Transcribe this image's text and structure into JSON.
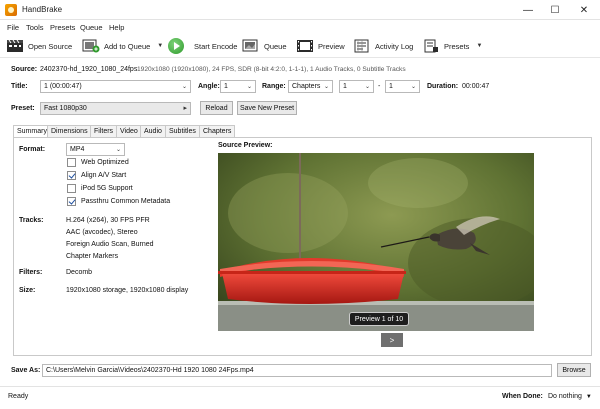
{
  "window": {
    "title": "HandBrake",
    "minimize": "—",
    "maximize": "☐",
    "close": "✕"
  },
  "menu": [
    "File",
    "Tools",
    "Presets",
    "Queue",
    "Help"
  ],
  "toolbar": {
    "open_source": "Open Source",
    "add_to_queue": "Add to Queue",
    "start_encode": "Start Encode",
    "queue": "Queue",
    "preview": "Preview",
    "activity_log": "Activity Log",
    "presets": "Presets"
  },
  "source": {
    "label": "Source:",
    "name": "2402370-hd_1920_1080_24fps",
    "details": "1920x1080 (1920x1080), 24 FPS, SDR (8-bit 4:2:0, 1-1-1), 1 Audio Tracks, 0 Subtitle Tracks"
  },
  "title_row": {
    "title_label": "Title:",
    "title_value": "1 (00:00:47)",
    "angle_label": "Angle:",
    "angle_value": "1",
    "range_label": "Range:",
    "range_value": "Chapters",
    "range_start": "1",
    "range_sep": "-",
    "range_end": "1",
    "duration_label": "Duration:",
    "duration_value": "00:00:47"
  },
  "preset": {
    "label": "Preset:",
    "value": "Fast 1080p30",
    "reload": "Reload",
    "save_new": "Save New Preset"
  },
  "tabs": [
    "Summary",
    "Dimensions",
    "Filters",
    "Video",
    "Audio",
    "Subtitles",
    "Chapters"
  ],
  "summary": {
    "format_label": "Format:",
    "format_value": "MP4",
    "options": [
      {
        "label": "Web Optimized",
        "checked": false
      },
      {
        "label": "Align A/V Start",
        "checked": true
      },
      {
        "label": "iPod 5G Support",
        "checked": false
      },
      {
        "label": "Passthru Common Metadata",
        "checked": true
      }
    ],
    "tracks_label": "Tracks:",
    "tracks": [
      "H.264 (x264), 30 FPS PFR",
      "AAC (avcodec), Stereo",
      "Foreign Audio Scan, Burned",
      "Chapter Markers"
    ],
    "filters_label": "Filters:",
    "filters_value": "Decomb",
    "size_label": "Size:",
    "size_value": "1920x1080 storage, 1920x1080 display",
    "source_preview_label": "Source Preview:",
    "preview_counter": "Preview 1 of 10",
    "next_button": ">"
  },
  "save_as": {
    "label": "Save As:",
    "path": "C:\\Users\\Melvin Garcia\\Videos\\2402370-Hd 1920 1080 24Fps.mp4",
    "browse": "Browse"
  },
  "status": {
    "text": "Ready",
    "when_done_label": "When Done:",
    "when_done_value": "Do nothing"
  },
  "colors": {
    "accent": "#1f4f9e",
    "feeder_red": "#d42a20",
    "play_green": "#2f9a2c"
  }
}
